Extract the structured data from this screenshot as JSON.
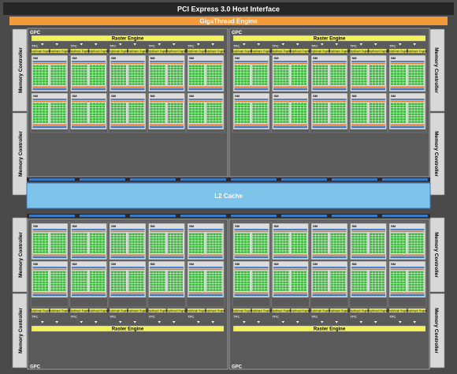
{
  "diagram": {
    "pci_express": "PCI Express 3.0 Host Interface",
    "gigathread": "GigaThread Engine",
    "l2_cache": "L2 Cache",
    "memory_controller": "Memory Controller",
    "gpc": "GPC",
    "raster_engine": "Raster Engine",
    "tpc": "TPC",
    "sm": "SM",
    "polymorph_engine": "PolyMorph Engine"
  },
  "colors": {
    "background": "#4a4a4a",
    "pci_bar": "#2a2a2a",
    "gigathread": "#f59a3a",
    "l2_cache": "#7ec3ea",
    "memory_controller": "#d8d8d8",
    "raster_engine": "#f2f25c",
    "polymorph_engine": "#eaea50",
    "cuda_core": "#3db83d",
    "register_blue": "#3a78c8",
    "special_orange": "#e07828",
    "sm_fill": "#dcdcdc"
  }
}
